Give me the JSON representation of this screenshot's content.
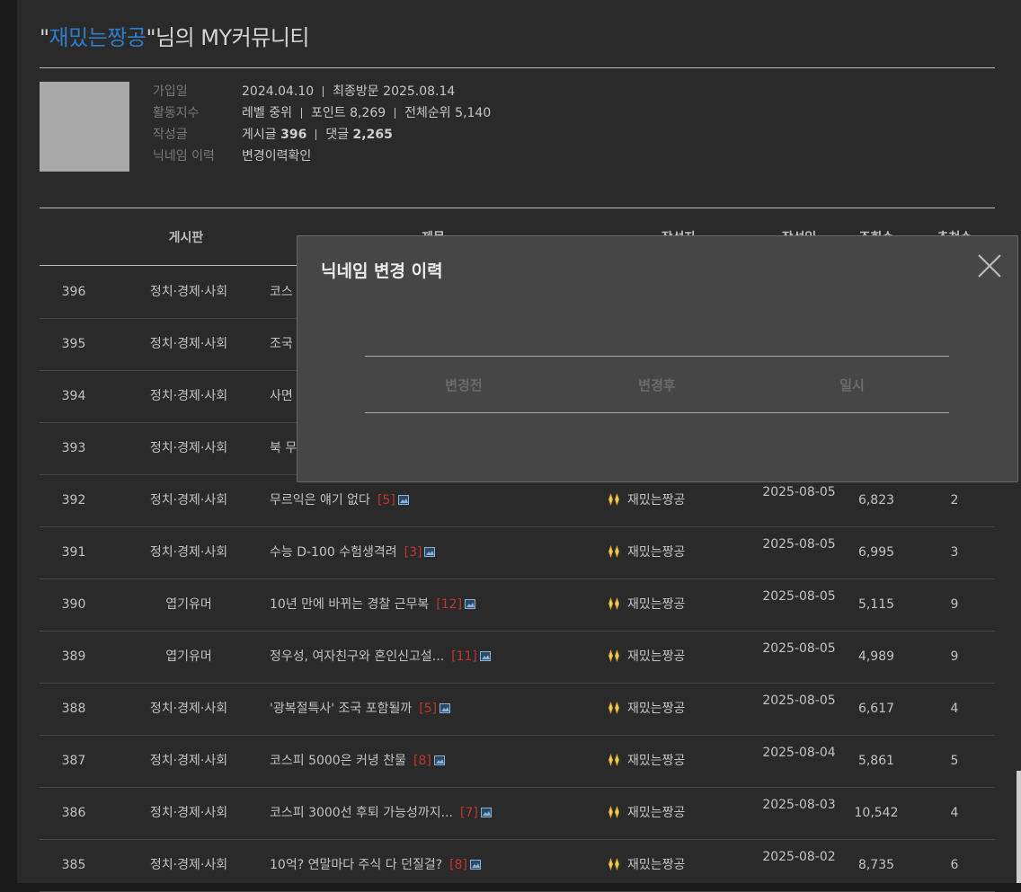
{
  "header": {
    "quote_open": "\"",
    "nickname": "재밌는짱공",
    "quote_close": "\"",
    "suffix": "님의 MY커뮤니티"
  },
  "profile": {
    "joined_label": "가입일",
    "joined_value": "2024.04.10",
    "last_visit_label": "최종방문",
    "last_visit_value": "2025.08.14",
    "activity_label": "활동지수",
    "level_label": "레벨",
    "level_value": "중위",
    "points_label": "포인트",
    "points_value": "8,269",
    "rank_label": "전체순위",
    "rank_value": "5,140",
    "posts_label": "작성글",
    "post_count_label": "게시글",
    "post_count": "396",
    "comment_count_label": "댓글",
    "comment_count": "2,265",
    "nick_history_label": "닉네임 이력",
    "nick_history_link": "변경이력확인"
  },
  "table": {
    "headers": {
      "board": "게시판",
      "title": "제목",
      "author": "작성자",
      "date": "작성일",
      "views": "조회수",
      "recommend": "추천수"
    },
    "rows": [
      {
        "num": "396",
        "board": "정치·경제·사회",
        "title": "코스",
        "comments": "",
        "author": "",
        "date": "",
        "views": "",
        "rec": ""
      },
      {
        "num": "395",
        "board": "정치·경제·사회",
        "title": "조국",
        "comments": "",
        "author": "",
        "date": "",
        "views": "",
        "rec": ""
      },
      {
        "num": "394",
        "board": "정치·경제·사회",
        "title": "사면",
        "comments": "",
        "author": "",
        "date": "",
        "views": "",
        "rec": ""
      },
      {
        "num": "393",
        "board": "정치·경제·사회",
        "title": "북 무",
        "comments": "",
        "author": "",
        "date": "",
        "views": "",
        "rec": ""
      },
      {
        "num": "392",
        "board": "정치·경제·사회",
        "title": "무르익은 얘기 없다",
        "comments": "[5]",
        "author": "재밌는짱공",
        "date": "2025-08-05",
        "views": "6,823",
        "rec": "2"
      },
      {
        "num": "391",
        "board": "정치·경제·사회",
        "title": "수능 D-100 수험생격려",
        "comments": "[3]",
        "author": "재밌는짱공",
        "date": "2025-08-05",
        "views": "6,995",
        "rec": "3"
      },
      {
        "num": "390",
        "board": "엽기유머",
        "title": "10년 만에 바뀌는 경찰 근무복",
        "comments": "[12]",
        "author": "재밌는짱공",
        "date": "2025-08-05",
        "views": "5,115",
        "rec": "9"
      },
      {
        "num": "389",
        "board": "엽기유머",
        "title": "정우성, 여자친구와 혼인신고설...",
        "comments": "[11]",
        "author": "재밌는짱공",
        "date": "2025-08-05",
        "views": "4,989",
        "rec": "9"
      },
      {
        "num": "388",
        "board": "정치·경제·사회",
        "title": "'광복절특사' 조국 포함될까",
        "comments": "[5]",
        "author": "재밌는짱공",
        "date": "2025-08-05",
        "views": "6,617",
        "rec": "4"
      },
      {
        "num": "387",
        "board": "정치·경제·사회",
        "title": "코스피 5000은 커녕 찬물",
        "comments": "[8]",
        "author": "재밌는짱공",
        "date": "2025-08-04",
        "views": "5,861",
        "rec": "5"
      },
      {
        "num": "386",
        "board": "정치·경제·사회",
        "title": "코스피 3000선 후퇴 가능성까지...",
        "comments": "[7]",
        "author": "재밌는짱공",
        "date": "2025-08-03",
        "views": "10,542",
        "rec": "4"
      },
      {
        "num": "385",
        "board": "정치·경제·사회",
        "title": "10억? 연말마다 주식 다 던질걸?",
        "comments": "[8]",
        "author": "재밌는짱공",
        "date": "2025-08-02",
        "views": "8,735",
        "rec": "6"
      }
    ]
  },
  "modal": {
    "title": "닉네임 변경 이력",
    "col_before": "변경전",
    "col_after": "변경후",
    "col_date": "일시"
  },
  "colors": {
    "nickname": "#2f7ccb",
    "comment_count": "#c2352c",
    "background": "#2a2a2a",
    "modal_bg": "#464646"
  }
}
